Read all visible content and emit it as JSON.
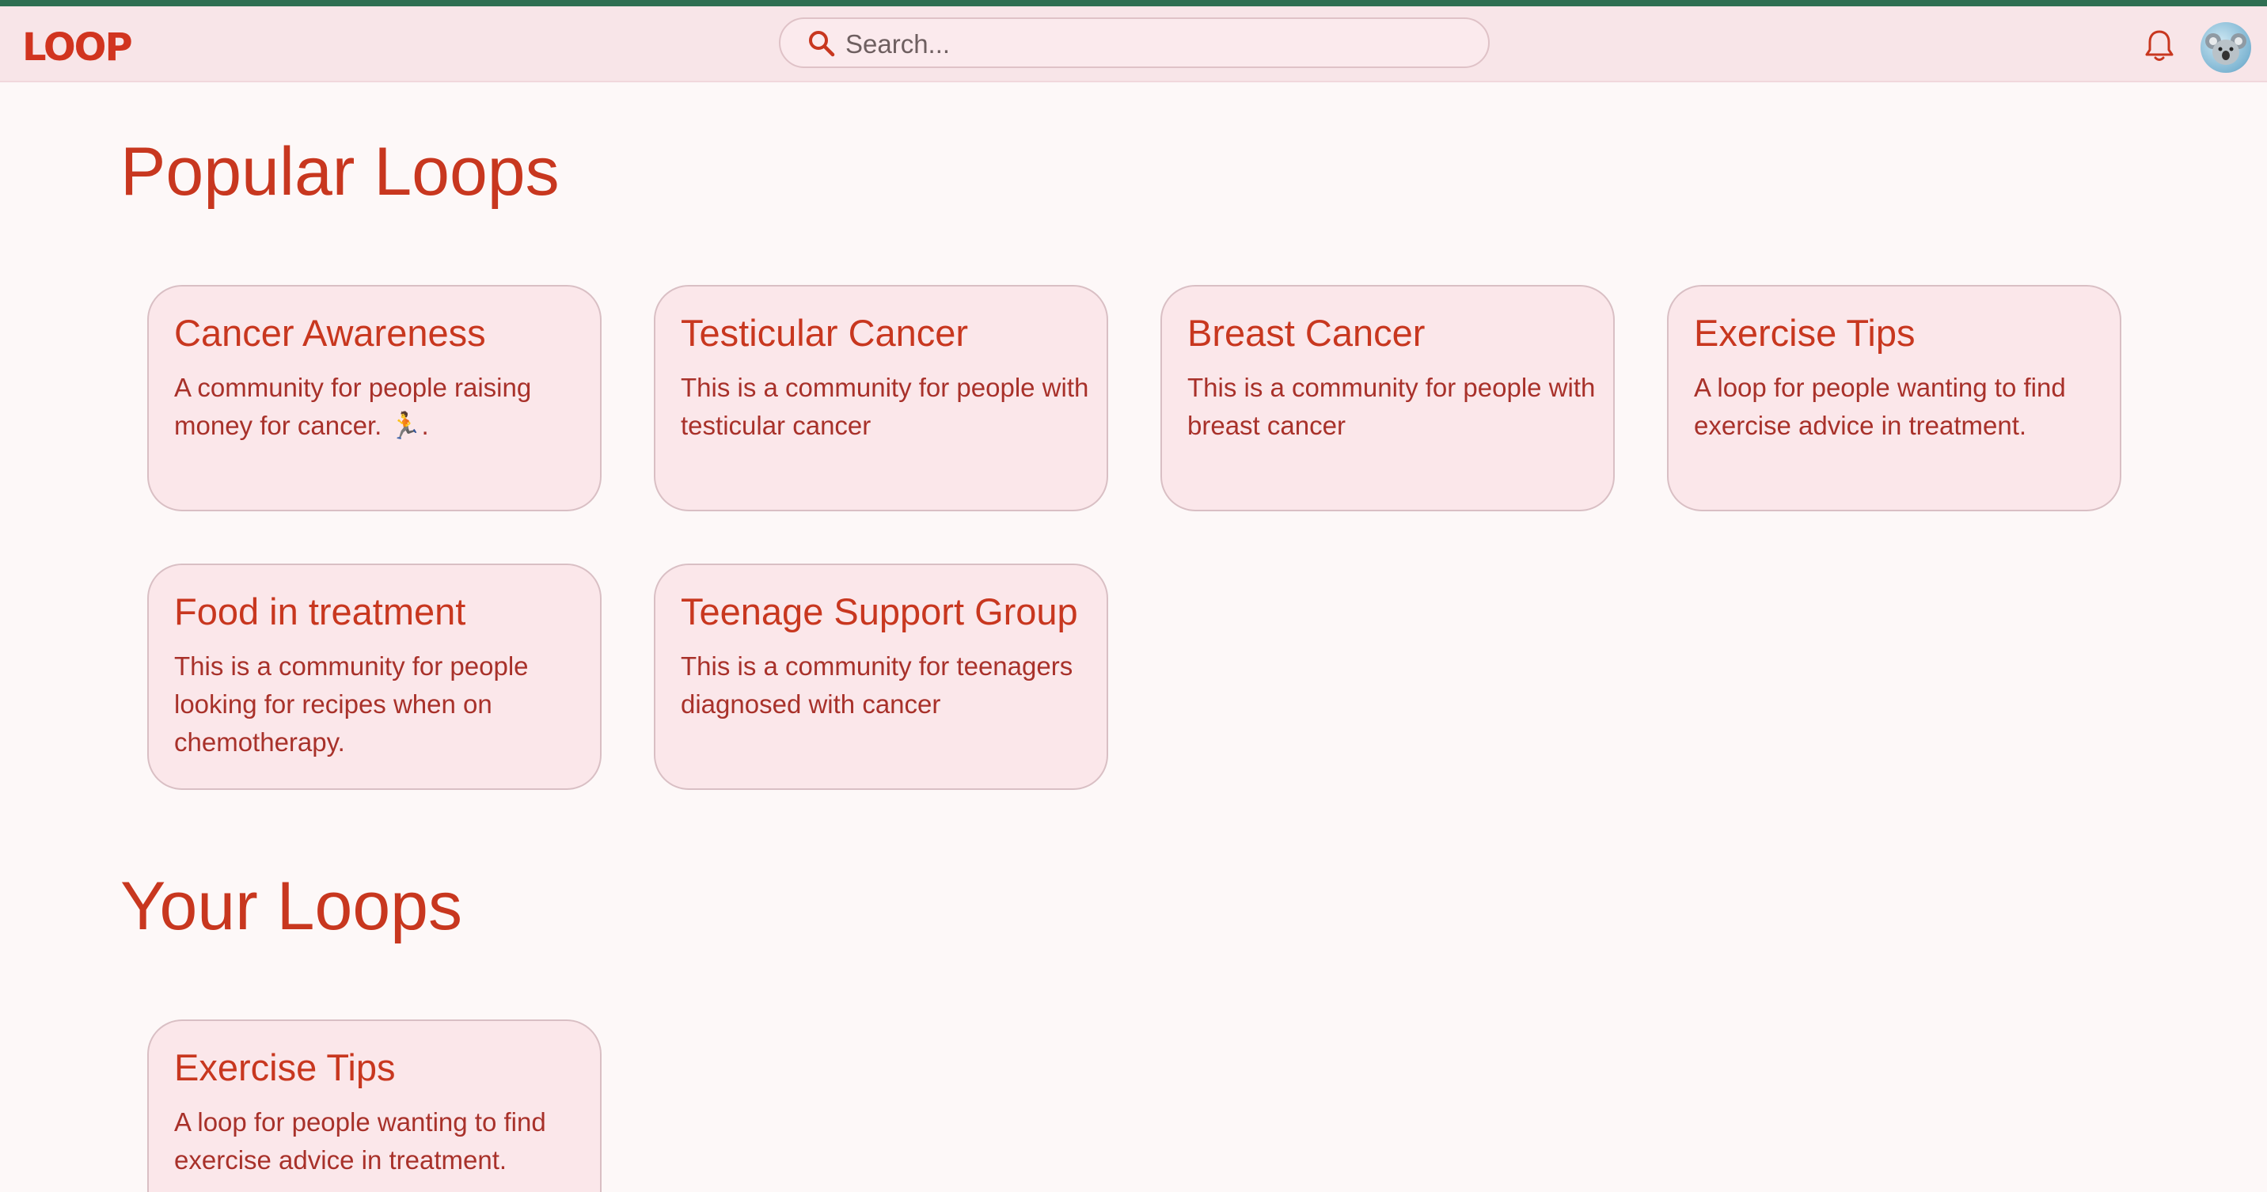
{
  "header": {
    "logo_text": "LOOP",
    "search_placeholder": "Search...",
    "search_icon": "search-icon",
    "notifications_icon": "bell-icon",
    "avatar_icon": "koala-avatar"
  },
  "colors": {
    "accent": "#c8371f",
    "top_bar": "#2f6f52",
    "header_bg": "#f8e5e8",
    "card_bg": "#fbe7ea",
    "page_bg": "#fdf8f8"
  },
  "popular": {
    "title": "Popular Loops",
    "cards": [
      {
        "title": "Cancer Awareness",
        "description": "A community for people raising money for cancer. 🏃."
      },
      {
        "title": "Testicular Cancer",
        "description": "This is a community for people with testicular cancer"
      },
      {
        "title": "Breast Cancer",
        "description": "This is a community for people with breast cancer"
      },
      {
        "title": "Exercise Tips",
        "description": "A loop for people wanting to find exercise advice in treatment."
      },
      {
        "title": "Food in treatment",
        "description": "This is a community for people looking for recipes when on chemotherapy."
      },
      {
        "title": "Teenage Support Group",
        "description": "This is a community for teenagers diagnosed with cancer"
      }
    ]
  },
  "yours": {
    "title": "Your Loops",
    "cards": [
      {
        "title": "Exercise Tips",
        "description": "A loop for people wanting to find exercise advice in treatment."
      }
    ]
  }
}
